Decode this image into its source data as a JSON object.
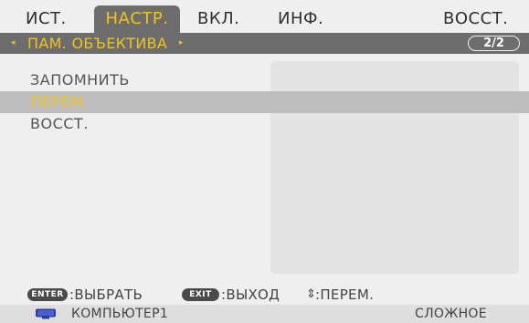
{
  "tabs": [
    {
      "label": "ИСТ.",
      "active": false
    },
    {
      "label": "НАСТР.",
      "active": true
    },
    {
      "label": "ВКЛ.",
      "active": false
    },
    {
      "label": "ИНФ.",
      "active": false
    },
    {
      "label": "ВОССТ.",
      "active": false
    }
  ],
  "submenu": {
    "title": "ПАМ. ОБЪЕКТИВА",
    "page_indicator": "2/2",
    "left_arrow": "◂",
    "right_arrow": "▸"
  },
  "menu_items": [
    {
      "label": "ЗАПОМНИТЬ",
      "selected": false
    },
    {
      "label": "ПЕРЕМ.",
      "selected": true
    },
    {
      "label": "ВОССТ.",
      "selected": false
    }
  ],
  "help": {
    "enter_key": "ENTER",
    "enter_action": ":ВЫБРАТЬ",
    "exit_key": "EXIT",
    "exit_action": ":ВЫХОД",
    "move_symbol": "⇕",
    "move_action": ":ПЕРЕМ."
  },
  "status": {
    "source": "КОМПЬЮТЕР1",
    "mode": "СЛОЖНОЕ",
    "source_icon": "computer-monitor-icon"
  },
  "colors": {
    "accent": "#f3c21f",
    "bar": "#6d6d6d",
    "background": "#efefef",
    "selection": "#bdbdbd",
    "monitor_icon": "#2b3b9c"
  }
}
